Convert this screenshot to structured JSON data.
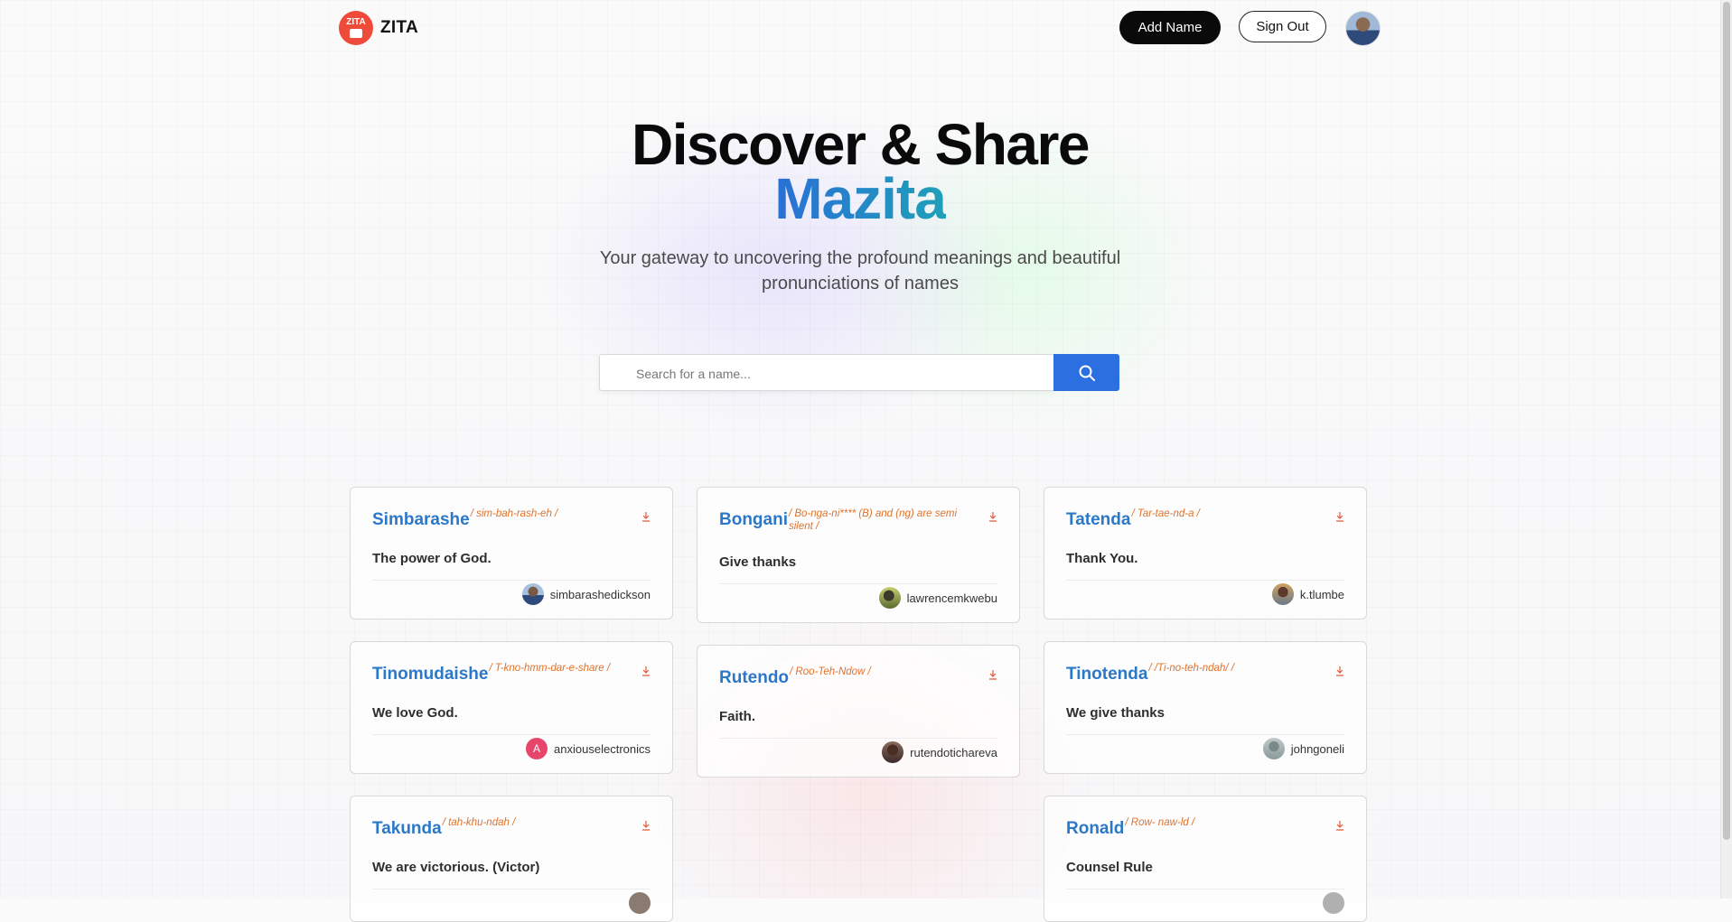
{
  "brand": {
    "logo_badge": "ZITA",
    "name": "ZITA"
  },
  "header": {
    "add_label": "Add Name",
    "signout_label": "Sign Out"
  },
  "hero": {
    "title": "Discover & Share",
    "accent": "Mazita",
    "subtitle": "Your gateway to uncovering the profound meanings and beautiful pronunciations of names"
  },
  "search": {
    "placeholder": "Search for a name..."
  },
  "colors": {
    "accent": "#2b6fe0",
    "name": "#2b78c8",
    "pronunciation": "#e0722a",
    "logo": "#ef4b3a"
  },
  "cards": [
    {
      "name": "Simbarashe",
      "pron": "/ sim-bah-rash-eh /",
      "meaning": "The power of God.",
      "user": "simbarashedickson"
    },
    {
      "name": "Bongani",
      "pron": "/ Bo-nga-ni**** (B) and (ng) are semi silent /",
      "meaning": "Give thanks",
      "user": "lawrencemkwebu"
    },
    {
      "name": "Tatenda",
      "pron": "/ Tar-tae-nd-a /",
      "meaning": "Thank You.",
      "user": "k.tlumbe"
    },
    {
      "name": "Tinomudaishe",
      "pron": "/ T-kno-hmm-dar-e-share /",
      "meaning": "We love God.",
      "user": "anxiouselectronics",
      "initial": "A"
    },
    {
      "name": "Rutendo",
      "pron": "/ Roo-Teh-Ndow /",
      "meaning": "Faith.",
      "user": "rutendotichareva"
    },
    {
      "name": "Tinotenda",
      "pron": "/ /Ti-no-teh-ndah/ /",
      "meaning": "We give thanks",
      "user": "johngoneli"
    },
    {
      "name": "Takunda",
      "pron": "/ tah-khu-ndah /",
      "meaning": "We are victorious. (Victor)",
      "user": ""
    },
    {
      "name": "Ronald",
      "pron": "/ Row- naw-ld /",
      "meaning": "Counsel Rule",
      "user": ""
    }
  ]
}
